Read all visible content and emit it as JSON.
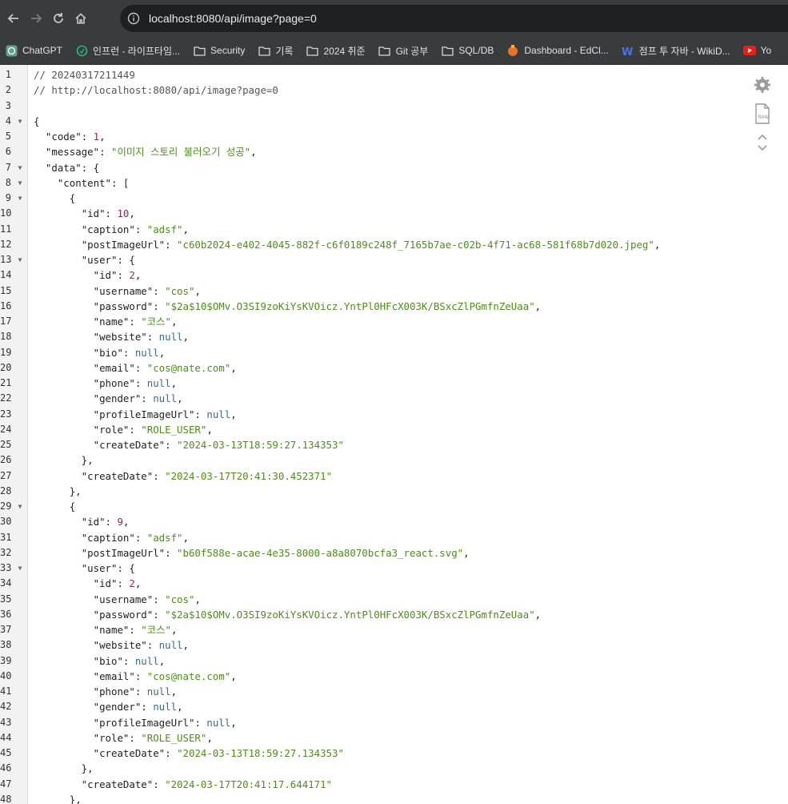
{
  "browser": {
    "url": "localhost:8080/api/image?page=0"
  },
  "bookmarks": [
    {
      "label": "ChatGPT",
      "icon": "chatgpt-icon"
    },
    {
      "label": "인프런 - 라이프타임...",
      "icon": "inflearn-icon"
    },
    {
      "label": "Security",
      "icon": "folder-icon"
    },
    {
      "label": "기록",
      "icon": "folder-icon"
    },
    {
      "label": "2024 취준",
      "icon": "folder-icon"
    },
    {
      "label": "Git 공부",
      "icon": "folder-icon"
    },
    {
      "label": "SQL/DB",
      "icon": "folder-icon"
    },
    {
      "label": "Dashboard - EdCl...",
      "icon": "edclass-icon"
    },
    {
      "label": "점프 투 자바 - WikiD...",
      "icon": "wikidocs-icon"
    },
    {
      "label": "Yo",
      "icon": "youtube-icon"
    }
  ],
  "json_lines": [
    {
      "n": "1",
      "fold": false,
      "seg": [
        [
          "c",
          "// 20240317211449"
        ]
      ]
    },
    {
      "n": "2",
      "fold": false,
      "seg": [
        [
          "c",
          "// http://localhost:8080/api/image?page=0"
        ]
      ]
    },
    {
      "n": "3",
      "fold": false,
      "seg": []
    },
    {
      "n": "4",
      "fold": true,
      "seg": [
        [
          "p",
          "{"
        ]
      ]
    },
    {
      "n": "5",
      "fold": false,
      "seg": [
        [
          "p",
          "  "
        ],
        [
          "k",
          "\"code\""
        ],
        [
          "p",
          ": "
        ],
        [
          "n",
          "1"
        ],
        [
          "p",
          ","
        ]
      ]
    },
    {
      "n": "6",
      "fold": false,
      "seg": [
        [
          "p",
          "  "
        ],
        [
          "k",
          "\"message\""
        ],
        [
          "p",
          ": "
        ],
        [
          "s",
          "\"이미지 스토리 불러오기 성공\""
        ],
        [
          "p",
          ","
        ]
      ]
    },
    {
      "n": "7",
      "fold": true,
      "seg": [
        [
          "p",
          "  "
        ],
        [
          "k",
          "\"data\""
        ],
        [
          "p",
          ": {"
        ]
      ]
    },
    {
      "n": "8",
      "fold": true,
      "seg": [
        [
          "p",
          "    "
        ],
        [
          "k",
          "\"content\""
        ],
        [
          "p",
          ": ["
        ]
      ]
    },
    {
      "n": "9",
      "fold": true,
      "seg": [
        [
          "p",
          "      {"
        ]
      ]
    },
    {
      "n": "10",
      "fold": false,
      "seg": [
        [
          "p",
          "        "
        ],
        [
          "k",
          "\"id\""
        ],
        [
          "p",
          ": "
        ],
        [
          "n",
          "10"
        ],
        [
          "p",
          ","
        ]
      ]
    },
    {
      "n": "11",
      "fold": false,
      "seg": [
        [
          "p",
          "        "
        ],
        [
          "k",
          "\"caption\""
        ],
        [
          "p",
          ": "
        ],
        [
          "s",
          "\"adsf\""
        ],
        [
          "p",
          ","
        ]
      ]
    },
    {
      "n": "12",
      "fold": false,
      "seg": [
        [
          "p",
          "        "
        ],
        [
          "k",
          "\"postImageUrl\""
        ],
        [
          "p",
          ": "
        ],
        [
          "s",
          "\"c60b2024-e402-4045-882f-c6f0189c248f_7165b7ae-c02b-4f71-ac68-581f68b7d020.jpeg\""
        ],
        [
          "p",
          ","
        ]
      ]
    },
    {
      "n": "13",
      "fold": true,
      "seg": [
        [
          "p",
          "        "
        ],
        [
          "k",
          "\"user\""
        ],
        [
          "p",
          ": {"
        ]
      ]
    },
    {
      "n": "14",
      "fold": false,
      "seg": [
        [
          "p",
          "          "
        ],
        [
          "k",
          "\"id\""
        ],
        [
          "p",
          ": "
        ],
        [
          "n",
          "2"
        ],
        [
          "p",
          ","
        ]
      ]
    },
    {
      "n": "15",
      "fold": false,
      "seg": [
        [
          "p",
          "          "
        ],
        [
          "k",
          "\"username\""
        ],
        [
          "p",
          ": "
        ],
        [
          "s",
          "\"cos\""
        ],
        [
          "p",
          ","
        ]
      ]
    },
    {
      "n": "16",
      "fold": false,
      "seg": [
        [
          "p",
          "          "
        ],
        [
          "k",
          "\"password\""
        ],
        [
          "p",
          ": "
        ],
        [
          "s",
          "\"$2a$10$OMv.O3SI9zoKiYsKVOicz.YntPl0HFcX003K/BSxcZlPGmfnZeUaa\""
        ],
        [
          "p",
          ","
        ]
      ]
    },
    {
      "n": "17",
      "fold": false,
      "seg": [
        [
          "p",
          "          "
        ],
        [
          "k",
          "\"name\""
        ],
        [
          "p",
          ": "
        ],
        [
          "s",
          "\"코스\""
        ],
        [
          "p",
          ","
        ]
      ]
    },
    {
      "n": "18",
      "fold": false,
      "seg": [
        [
          "p",
          "          "
        ],
        [
          "k",
          "\"website\""
        ],
        [
          "p",
          ": "
        ],
        [
          "u",
          "null"
        ],
        [
          "p",
          ","
        ]
      ]
    },
    {
      "n": "19",
      "fold": false,
      "seg": [
        [
          "p",
          "          "
        ],
        [
          "k",
          "\"bio\""
        ],
        [
          "p",
          ": "
        ],
        [
          "u",
          "null"
        ],
        [
          "p",
          ","
        ]
      ]
    },
    {
      "n": "20",
      "fold": false,
      "seg": [
        [
          "p",
          "          "
        ],
        [
          "k",
          "\"email\""
        ],
        [
          "p",
          ": "
        ],
        [
          "s",
          "\"cos@nate.com\""
        ],
        [
          "p",
          ","
        ]
      ]
    },
    {
      "n": "21",
      "fold": false,
      "seg": [
        [
          "p",
          "          "
        ],
        [
          "k",
          "\"phone\""
        ],
        [
          "p",
          ": "
        ],
        [
          "u",
          "null"
        ],
        [
          "p",
          ","
        ]
      ]
    },
    {
      "n": "22",
      "fold": false,
      "seg": [
        [
          "p",
          "          "
        ],
        [
          "k",
          "\"gender\""
        ],
        [
          "p",
          ": "
        ],
        [
          "u",
          "null"
        ],
        [
          "p",
          ","
        ]
      ]
    },
    {
      "n": "23",
      "fold": false,
      "seg": [
        [
          "p",
          "          "
        ],
        [
          "k",
          "\"profileImageUrl\""
        ],
        [
          "p",
          ": "
        ],
        [
          "u",
          "null"
        ],
        [
          "p",
          ","
        ]
      ]
    },
    {
      "n": "24",
      "fold": false,
      "seg": [
        [
          "p",
          "          "
        ],
        [
          "k",
          "\"role\""
        ],
        [
          "p",
          ": "
        ],
        [
          "s",
          "\"ROLE_USER\""
        ],
        [
          "p",
          ","
        ]
      ]
    },
    {
      "n": "25",
      "fold": false,
      "seg": [
        [
          "p",
          "          "
        ],
        [
          "k",
          "\"createDate\""
        ],
        [
          "p",
          ": "
        ],
        [
          "s",
          "\"2024-03-13T18:59:27.134353\""
        ]
      ]
    },
    {
      "n": "26",
      "fold": false,
      "seg": [
        [
          "p",
          "        },"
        ]
      ]
    },
    {
      "n": "27",
      "fold": false,
      "seg": [
        [
          "p",
          "        "
        ],
        [
          "k",
          "\"createDate\""
        ],
        [
          "p",
          ": "
        ],
        [
          "s",
          "\"2024-03-17T20:41:30.452371\""
        ]
      ]
    },
    {
      "n": "28",
      "fold": false,
      "seg": [
        [
          "p",
          "      },"
        ]
      ]
    },
    {
      "n": "29",
      "fold": true,
      "seg": [
        [
          "p",
          "      {"
        ]
      ]
    },
    {
      "n": "30",
      "fold": false,
      "seg": [
        [
          "p",
          "        "
        ],
        [
          "k",
          "\"id\""
        ],
        [
          "p",
          ": "
        ],
        [
          "n",
          "9"
        ],
        [
          "p",
          ","
        ]
      ]
    },
    {
      "n": "31",
      "fold": false,
      "seg": [
        [
          "p",
          "        "
        ],
        [
          "k",
          "\"caption\""
        ],
        [
          "p",
          ": "
        ],
        [
          "s",
          "\"adsf\""
        ],
        [
          "p",
          ","
        ]
      ]
    },
    {
      "n": "32",
      "fold": false,
      "seg": [
        [
          "p",
          "        "
        ],
        [
          "k",
          "\"postImageUrl\""
        ],
        [
          "p",
          ": "
        ],
        [
          "s",
          "\"b60f588e-acae-4e35-8000-a8a8070bcfa3_react.svg\""
        ],
        [
          "p",
          ","
        ]
      ]
    },
    {
      "n": "33",
      "fold": true,
      "seg": [
        [
          "p",
          "        "
        ],
        [
          "k",
          "\"user\""
        ],
        [
          "p",
          ": {"
        ]
      ]
    },
    {
      "n": "34",
      "fold": false,
      "seg": [
        [
          "p",
          "          "
        ],
        [
          "k",
          "\"id\""
        ],
        [
          "p",
          ": "
        ],
        [
          "n",
          "2"
        ],
        [
          "p",
          ","
        ]
      ]
    },
    {
      "n": "35",
      "fold": false,
      "seg": [
        [
          "p",
          "          "
        ],
        [
          "k",
          "\"username\""
        ],
        [
          "p",
          ": "
        ],
        [
          "s",
          "\"cos\""
        ],
        [
          "p",
          ","
        ]
      ]
    },
    {
      "n": "36",
      "fold": false,
      "seg": [
        [
          "p",
          "          "
        ],
        [
          "k",
          "\"password\""
        ],
        [
          "p",
          ": "
        ],
        [
          "s",
          "\"$2a$10$OMv.O3SI9zoKiYsKVOicz.YntPl0HFcX003K/BSxcZlPGmfnZeUaa\""
        ],
        [
          "p",
          ","
        ]
      ]
    },
    {
      "n": "37",
      "fold": false,
      "seg": [
        [
          "p",
          "          "
        ],
        [
          "k",
          "\"name\""
        ],
        [
          "p",
          ": "
        ],
        [
          "s",
          "\"코스\""
        ],
        [
          "p",
          ","
        ]
      ]
    },
    {
      "n": "38",
      "fold": false,
      "seg": [
        [
          "p",
          "          "
        ],
        [
          "k",
          "\"website\""
        ],
        [
          "p",
          ": "
        ],
        [
          "u",
          "null"
        ],
        [
          "p",
          ","
        ]
      ]
    },
    {
      "n": "39",
      "fold": false,
      "seg": [
        [
          "p",
          "          "
        ],
        [
          "k",
          "\"bio\""
        ],
        [
          "p",
          ": "
        ],
        [
          "u",
          "null"
        ],
        [
          "p",
          ","
        ]
      ]
    },
    {
      "n": "40",
      "fold": false,
      "seg": [
        [
          "p",
          "          "
        ],
        [
          "k",
          "\"email\""
        ],
        [
          "p",
          ": "
        ],
        [
          "s",
          "\"cos@nate.com\""
        ],
        [
          "p",
          ","
        ]
      ]
    },
    {
      "n": "41",
      "fold": false,
      "seg": [
        [
          "p",
          "          "
        ],
        [
          "k",
          "\"phone\""
        ],
        [
          "p",
          ": "
        ],
        [
          "u",
          "null"
        ],
        [
          "p",
          ","
        ]
      ]
    },
    {
      "n": "42",
      "fold": false,
      "seg": [
        [
          "p",
          "          "
        ],
        [
          "k",
          "\"gender\""
        ],
        [
          "p",
          ": "
        ],
        [
          "u",
          "null"
        ],
        [
          "p",
          ","
        ]
      ]
    },
    {
      "n": "43",
      "fold": false,
      "seg": [
        [
          "p",
          "          "
        ],
        [
          "k",
          "\"profileImageUrl\""
        ],
        [
          "p",
          ": "
        ],
        [
          "u",
          "null"
        ],
        [
          "p",
          ","
        ]
      ]
    },
    {
      "n": "44",
      "fold": false,
      "seg": [
        [
          "p",
          "          "
        ],
        [
          "k",
          "\"role\""
        ],
        [
          "p",
          ": "
        ],
        [
          "s",
          "\"ROLE_USER\""
        ],
        [
          "p",
          ","
        ]
      ]
    },
    {
      "n": "45",
      "fold": false,
      "seg": [
        [
          "p",
          "          "
        ],
        [
          "k",
          "\"createDate\""
        ],
        [
          "p",
          ": "
        ],
        [
          "s",
          "\"2024-03-13T18:59:27.134353\""
        ]
      ]
    },
    {
      "n": "46",
      "fold": false,
      "seg": [
        [
          "p",
          "        },"
        ]
      ]
    },
    {
      "n": "47",
      "fold": false,
      "seg": [
        [
          "p",
          "        "
        ],
        [
          "k",
          "\"createDate\""
        ],
        [
          "p",
          ": "
        ],
        [
          "s",
          "\"2024-03-17T20:41:17.644171\""
        ]
      ]
    },
    {
      "n": "48",
      "fold": false,
      "seg": [
        [
          "p",
          "      },"
        ]
      ]
    }
  ],
  "side_tools": {
    "settings_icon": "gear-icon",
    "raw_icon": "raw-file-icon",
    "toggle_icon": "expand-collapse-icon"
  },
  "colors": {
    "toolbar_bg": "#3a3b3d",
    "string": "#4b8e1a",
    "number": "#8a2b5c",
    "null": "#3a6a8a"
  }
}
